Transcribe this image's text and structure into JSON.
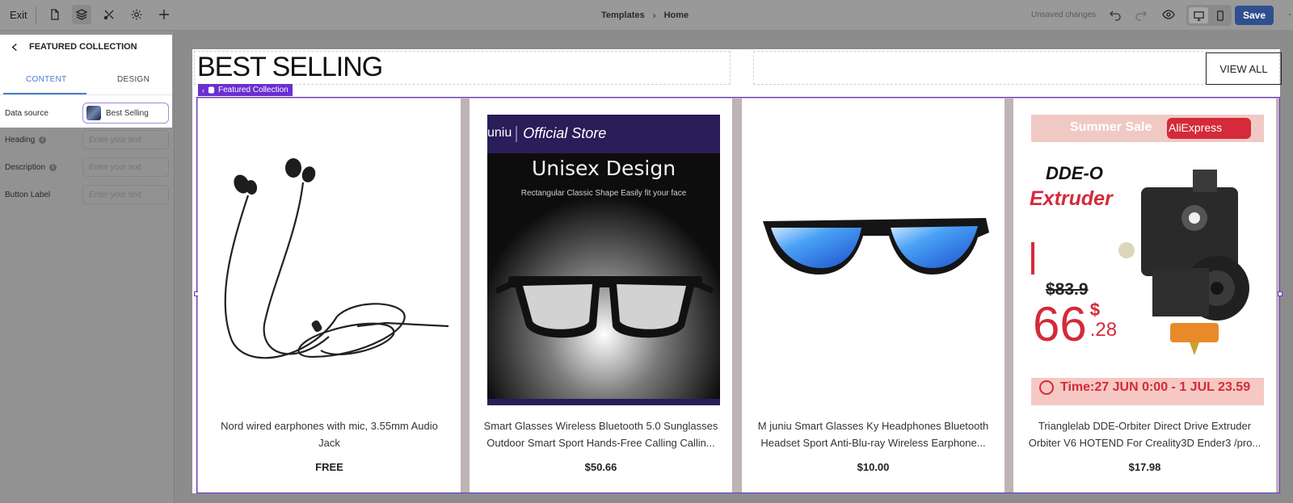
{
  "topbar": {
    "exit_label": "Exit",
    "breadcrumb": [
      "Templates",
      "Home"
    ],
    "status": "Unsaved changes",
    "save_label": "Save"
  },
  "panel": {
    "title": "FEATURED COLLECTION",
    "tabs": [
      "CONTENT",
      "DESIGN"
    ],
    "active_tab": "CONTENT",
    "fields": {
      "data_source": {
        "label": "Data source",
        "value": "Best Selling"
      },
      "heading": {
        "label": "Heading",
        "placeholder": "Enter your text"
      },
      "description": {
        "label": "Description",
        "placeholder": "Enter your text"
      },
      "button_label": {
        "label": "Button Label",
        "placeholder": "Enter your text"
      }
    }
  },
  "canvas": {
    "section_title": "BEST SELLING",
    "view_all": "VIEW ALL",
    "component_tag": "Featured Collection",
    "products": [
      {
        "title": "Nord wired earphones with mic, 3.55mm Audio Jack",
        "price": "FREE"
      },
      {
        "title": "Smart Glasses Wireless Bluetooth 5.0 Sunglasses Outdoor Smart Sport Hands-Free Calling Callin...",
        "price": "$50.66",
        "image_text": {
          "store": "Official Store",
          "store_prefix": "uniu",
          "headline": "Unisex Design",
          "sub": "Rectangular Classic Shape Easily fit your face"
        }
      },
      {
        "title": "M juniu Smart Glasses Ky Headphones Bluetooth Headset Sport Anti-Blu-ray Wireless Earphone...",
        "price": "$10.00"
      },
      {
        "title": "Trianglelab DDE-Orbiter Direct Drive Extruder Orbiter V6 HOTEND For Creality3D Ender3 /pro...",
        "price": "$17.98",
        "image_text": {
          "banner": "Summer Sale",
          "brand": "AliExpress",
          "product_line1": "DDE-O",
          "product_line2": "Extruder",
          "old_price": "$83.9",
          "new_price_main": "66",
          "new_price_currency": "$",
          "new_price_cents": ".28",
          "time": "Time:27 JUN 0:00 - 1 JUL 23.59"
        }
      }
    ]
  },
  "colors": {
    "accent": "#6a2fd0",
    "save": "#2f4f8f",
    "tab_active": "#4a7bd0",
    "sale_red": "#d42a3a"
  }
}
